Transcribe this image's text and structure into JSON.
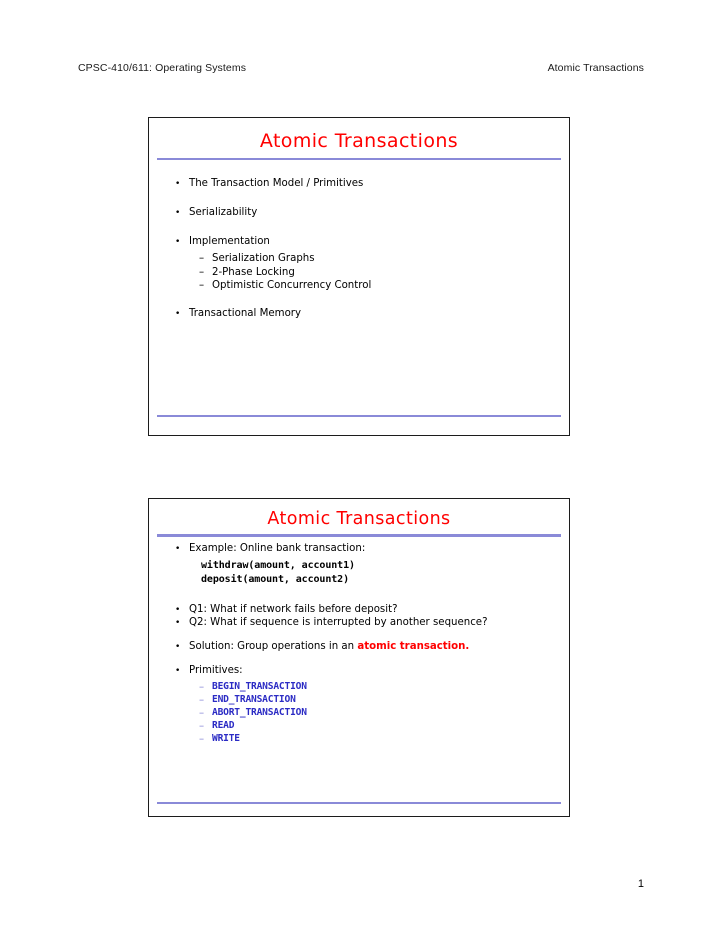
{
  "header": {
    "left": "CPSC-410/611: Operating Systems",
    "right": "Atomic Transactions"
  },
  "colors": {
    "title_red": "#ff0000",
    "rule_blue": "#8a8ad8",
    "primitive_blue": "#2b2bc4",
    "border": "#1c1c1c"
  },
  "slides": [
    {
      "title": "Atomic Transactions",
      "bullets": [
        {
          "marker": "•",
          "text": "The Transaction Model / Primitives"
        },
        {
          "marker": "•",
          "text": "Serializability"
        },
        {
          "marker": "•",
          "text": "Implementation"
        },
        {
          "marker": "•",
          "text": "Transactional Memory"
        }
      ],
      "subbullets": [
        {
          "marker": "–",
          "text": "Serialization Graphs"
        },
        {
          "marker": "–",
          "text": "2-Phase Locking"
        },
        {
          "marker": "–",
          "text": "Optimistic Concurrency Control"
        }
      ]
    },
    {
      "title": "Atomic Transactions",
      "example_bullet": {
        "marker": "•",
        "text": "Example: Online bank transaction:"
      },
      "code": [
        "withdraw(amount, account1)",
        "deposit(amount, account2)"
      ],
      "questions": [
        {
          "marker": "•",
          "text": "Q1: What if network fails before deposit?"
        },
        {
          "marker": "•",
          "text": "Q2: What if sequence is interrupted by another sequence?"
        }
      ],
      "solution": {
        "marker": "•",
        "prefix": "Solution: Group operations in an ",
        "accent": "atomic transaction.",
        "suffix": ""
      },
      "primitives_bullet": {
        "marker": "•",
        "text": "Primitives:"
      },
      "primitives": [
        {
          "marker": "–",
          "text": "BEGIN_TRANSACTION"
        },
        {
          "marker": "–",
          "text": "END_TRANSACTION"
        },
        {
          "marker": "–",
          "text": "ABORT_TRANSACTION"
        },
        {
          "marker": "–",
          "text": "READ"
        },
        {
          "marker": "–",
          "text": "WRITE"
        }
      ]
    }
  ],
  "page_number": "1"
}
